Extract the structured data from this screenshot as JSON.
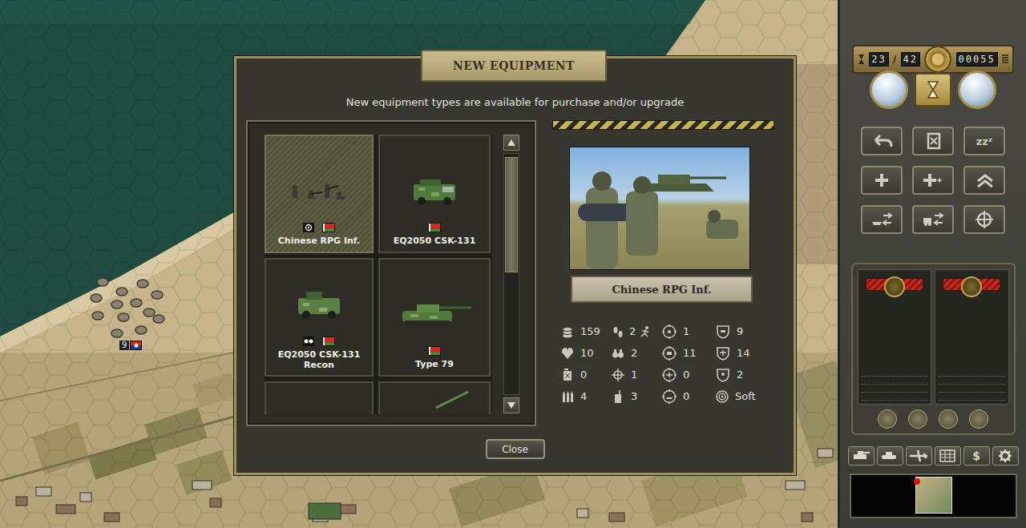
{
  "map": {
    "units": [
      {
        "strength": "9"
      }
    ]
  },
  "dialog": {
    "title": "NEW EQUIPMENT",
    "subtitle": "New equipment types are available for purchase and/or upgrade",
    "cards": [
      {
        "name": "Chinese RPG Inf.",
        "kind": "infantry",
        "badge": true,
        "selected": true
      },
      {
        "name": "EQ2050 CSK-131",
        "kind": "vehicle",
        "badge": false,
        "selected": false
      },
      {
        "name": "EQ2050 CSK-131 Recon",
        "kind": "recon",
        "badge": true,
        "selected": false
      },
      {
        "name": "Type 79",
        "kind": "artillery",
        "badge": false,
        "selected": false
      },
      {
        "kind": "partial",
        "badge": false,
        "selected": false
      },
      {
        "kind": "partial-gun",
        "badge": false,
        "selected": false
      }
    ],
    "scrollbar": {
      "level": 0.48
    },
    "unit": {
      "name": "Chinese RPG Inf.",
      "stats": [
        {
          "kind": "cost",
          "value": "159"
        },
        {
          "kind": "movement",
          "value": "2"
        },
        {
          "kind": "soft-attack",
          "value": "1"
        },
        {
          "kind": "ground-defense",
          "value": "9"
        },
        {
          "kind": "strength",
          "value": "10"
        },
        {
          "kind": "spotting",
          "value": "2"
        },
        {
          "kind": "hard-attack",
          "value": "11"
        },
        {
          "kind": "air-defense",
          "value": "14"
        },
        {
          "kind": "fuel",
          "value": "0"
        },
        {
          "kind": "range",
          "value": "1"
        },
        {
          "kind": "air-attack",
          "value": "0"
        },
        {
          "kind": "close-defense",
          "value": "2"
        },
        {
          "kind": "ammo",
          "value": "4"
        },
        {
          "kind": "initiative",
          "value": "3"
        },
        {
          "kind": "naval-attack",
          "value": "0"
        },
        {
          "kind": "target-type",
          "value": "Soft"
        }
      ]
    },
    "close": "Close"
  },
  "side": {
    "turn": "23",
    "separator": "/",
    "turns_total": "42",
    "prestige": "00055",
    "buttons": [
      {
        "kind": "undo"
      },
      {
        "kind": "card"
      },
      {
        "kind": "sleep",
        "glyph": "zzᶻ"
      },
      {
        "kind": "plus"
      },
      {
        "kind": "plus-star"
      },
      {
        "kind": "upgrade"
      },
      {
        "kind": "embark-ship"
      },
      {
        "kind": "embark-truck"
      },
      {
        "kind": "target"
      }
    ],
    "toolbar": [
      {
        "kind": "tank"
      },
      {
        "kind": "tank-alt"
      },
      {
        "kind": "plane"
      },
      {
        "kind": "grid"
      },
      {
        "kind": "money",
        "glyph": "$"
      },
      {
        "kind": "gear"
      }
    ]
  }
}
